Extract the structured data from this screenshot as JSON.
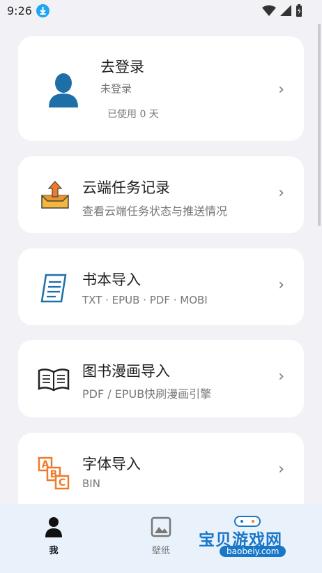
{
  "status_bar": {
    "time": "9:26"
  },
  "profile": {
    "title": "去登录",
    "status": "未登录",
    "usage": "已使用 0 天"
  },
  "menu": [
    {
      "title": "云端任务记录",
      "subtitle": "查看云端任务状态与推送情况",
      "icon": "cloud-upload-box-icon"
    },
    {
      "title": "书本导入",
      "subtitle": "TXT · EPUB · PDF · MOBI",
      "icon": "document-icon"
    },
    {
      "title": "图书漫画导入",
      "subtitle": "PDF / EPUB快刷漫画引擎",
      "icon": "open-book-icon"
    },
    {
      "title": "字体导入",
      "subtitle": "BIN",
      "icon": "abc-blocks-icon"
    }
  ],
  "bottom_nav": [
    {
      "label": "我",
      "active": true
    },
    {
      "label": "壁纸",
      "active": false
    }
  ],
  "watermark": {
    "text": "宝贝游戏网",
    "url": "baobeiy.com"
  },
  "colors": {
    "accent_blue": "#1e6fa8",
    "orange": "#f07a2a",
    "nav_bg": "#e9f1fb"
  }
}
